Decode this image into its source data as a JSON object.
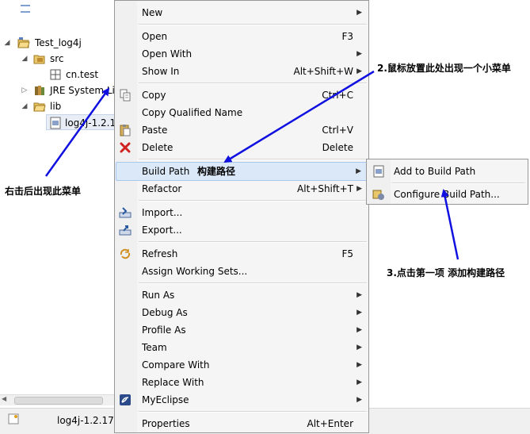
{
  "tree": {
    "project": "Test_log4j",
    "src": "src",
    "package": "cn.test",
    "jre": "JRE System Lib",
    "lib": "lib",
    "jar": "log4j-1.2.1"
  },
  "menu": {
    "items": [
      {
        "label": "New",
        "shortcut": "",
        "submenu": true
      },
      {
        "label": "Open",
        "shortcut": "F3",
        "submenu": false
      },
      {
        "label": "Open With",
        "shortcut": "",
        "submenu": true
      },
      {
        "label": "Show In",
        "shortcut": "Alt+Shift+W",
        "submenu": true
      },
      {
        "label": "Copy",
        "shortcut": "Ctrl+C",
        "submenu": false
      },
      {
        "label": "Copy Qualified Name",
        "shortcut": "",
        "submenu": false
      },
      {
        "label": "Paste",
        "shortcut": "Ctrl+V",
        "submenu": false
      },
      {
        "label": "Delete",
        "shortcut": "Delete",
        "submenu": false
      },
      {
        "label": "Build Path",
        "shortcut": "",
        "submenu": true
      },
      {
        "label": "Refactor",
        "shortcut": "Alt+Shift+T",
        "submenu": true
      },
      {
        "label": "Import...",
        "shortcut": "",
        "submenu": false
      },
      {
        "label": "Export...",
        "shortcut": "",
        "submenu": false
      },
      {
        "label": "Refresh",
        "shortcut": "F5",
        "submenu": false
      },
      {
        "label": "Assign Working Sets...",
        "shortcut": "",
        "submenu": false
      },
      {
        "label": "Run As",
        "shortcut": "",
        "submenu": true
      },
      {
        "label": "Debug As",
        "shortcut": "",
        "submenu": true
      },
      {
        "label": "Profile As",
        "shortcut": "",
        "submenu": true
      },
      {
        "label": "Team",
        "shortcut": "",
        "submenu": true
      },
      {
        "label": "Compare With",
        "shortcut": "",
        "submenu": true
      },
      {
        "label": "Replace With",
        "shortcut": "",
        "submenu": true
      },
      {
        "label": "MyEclipse",
        "shortcut": "",
        "submenu": true
      },
      {
        "label": "Properties",
        "shortcut": "Alt+Enter",
        "submenu": false
      }
    ]
  },
  "submenu": {
    "add_to_build_path": "Add to Build Path",
    "configure_build_path": "Configure Build Path..."
  },
  "annotations": {
    "right_click": "右击后出现此菜单",
    "hover_submenu": "2.鼠标放置此处出现一个小菜单",
    "build_path_cn": "构建路径",
    "click_first": "3.点击第一项 添加构建路径"
  },
  "statusbar": {
    "text": "log4j-1.2.17."
  },
  "colors": {
    "arrow": "#1010e0",
    "hover_bg": "#dbe8f8",
    "menu_bg": "#f5f5f5"
  }
}
